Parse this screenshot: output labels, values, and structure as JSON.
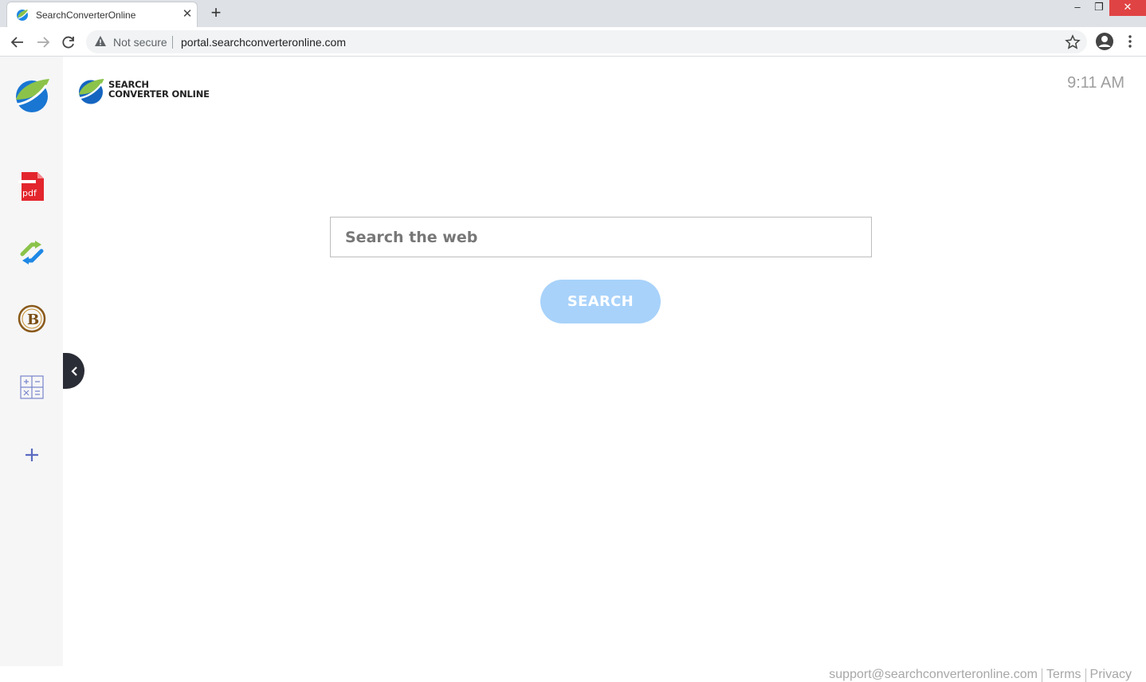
{
  "browser": {
    "tab_title": "SearchConverterOnline",
    "tab_close": "✕",
    "new_tab": "+",
    "security_label": "Not secure",
    "url": "portal.searchconverteronline.com",
    "window": {
      "minimize": "–",
      "maximize": "❐",
      "close": "✕"
    }
  },
  "page": {
    "logo": {
      "line1": "SEARCH",
      "line2": "CONVERTER ONLINE"
    },
    "clock": "9:11 AM",
    "search": {
      "placeholder": "Search the web",
      "button_label": "SEARCH"
    },
    "sidebar": {
      "items": [
        {
          "name": "home-logo-icon"
        },
        {
          "name": "pdf-icon",
          "label": "pdf"
        },
        {
          "name": "converter-arrows-icon"
        },
        {
          "name": "bitcoin-icon",
          "label": "B"
        },
        {
          "name": "calculator-icon"
        },
        {
          "name": "add-icon",
          "label": "+"
        }
      ]
    },
    "footer": {
      "email": "support@searchconverteronline.com",
      "terms": "Terms",
      "privacy": "Privacy"
    }
  },
  "colors": {
    "search_button": "#a8d2fa",
    "sidebar_bg": "#f6f6f7",
    "handle_bg": "#2b2d36",
    "pdf_red": "#e3262d",
    "accent_blue": "#1565c0",
    "accent_green": "#8bc34a"
  }
}
